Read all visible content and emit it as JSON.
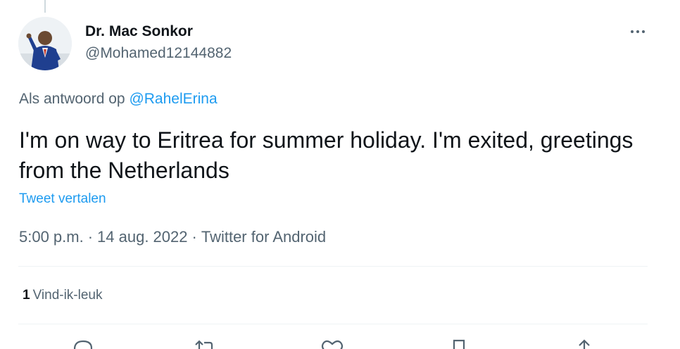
{
  "author": {
    "name": "Dr. Mac Sonkor",
    "handle": "@Mohamed12144882"
  },
  "reply_context": {
    "prefix": "Als antwoord op",
    "mention": "@RahelErina"
  },
  "tweet": {
    "text": "I'm on way to Eritrea for summer holiday. I'm exited, greetings from the Netherlands",
    "translate_label": "Tweet vertalen"
  },
  "meta": {
    "time": "5:00 p.m.",
    "separator": "·",
    "date": "14 aug. 2022",
    "source": "Twitter for Android"
  },
  "stats": {
    "likes_count": "1",
    "likes_label": "Vind-ik-leuk"
  },
  "actions": [
    {
      "name": "reply",
      "icon": "reply-icon"
    },
    {
      "name": "retweet",
      "icon": "retweet-icon"
    },
    {
      "name": "like",
      "icon": "heart-icon"
    },
    {
      "name": "bookmark",
      "icon": "bookmark-icon"
    },
    {
      "name": "share",
      "icon": "share-icon"
    }
  ],
  "colors": {
    "accent": "#1d9bf0",
    "text_primary": "#0f1419",
    "text_secondary": "#536471",
    "divider": "#eff3f4"
  }
}
